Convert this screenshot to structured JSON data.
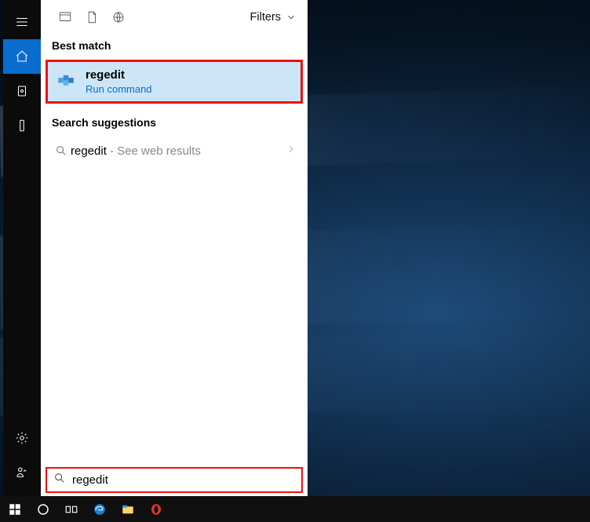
{
  "filters_label": "Filters",
  "best_match_label": "Best match",
  "best_match": {
    "title": "regedit",
    "subtitle": "Run command"
  },
  "suggest_label": "Search suggestions",
  "suggestion": {
    "term": "regedit",
    "hint": " - See web results"
  },
  "search_value": "regedit"
}
